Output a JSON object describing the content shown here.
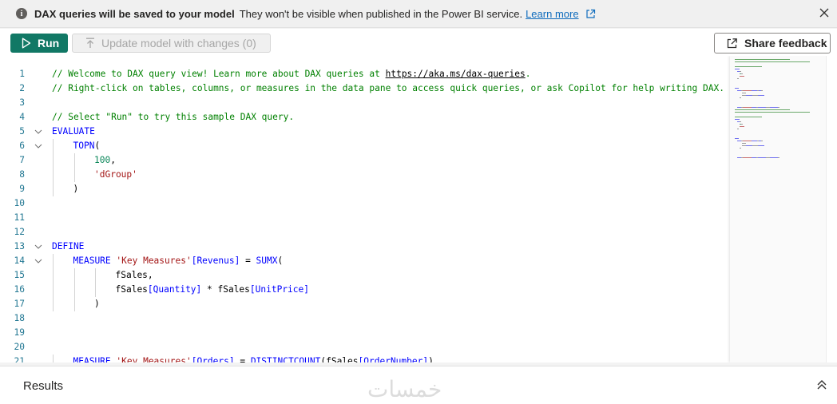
{
  "banner": {
    "title": "DAX queries will be saved to your model",
    "message": "They won't be visible when published in the Power BI service.",
    "link_label": "Learn more"
  },
  "toolbar": {
    "run_label": "Run",
    "update_label": "Update model with changes (0)",
    "share_label": "Share feedback"
  },
  "editor": {
    "lines": [
      {
        "n": "1",
        "indent": 0,
        "fold": false,
        "tokens": [
          [
            "c-comment",
            "// Welcome to DAX query view! Learn more about DAX queries at "
          ],
          [
            "c-link",
            "https://aka.ms/dax-queries"
          ],
          [
            "c-comment",
            "."
          ]
        ]
      },
      {
        "n": "2",
        "indent": 0,
        "fold": false,
        "tokens": [
          [
            "c-comment",
            "// Right-click on tables, columns, or measures in the data pane to access quick queries, or ask Copilot for help writing DAX."
          ]
        ]
      },
      {
        "n": "3",
        "indent": 0,
        "fold": false,
        "tokens": []
      },
      {
        "n": "4",
        "indent": 0,
        "fold": false,
        "tokens": [
          [
            "c-comment",
            "// Select \"Run\" to try this sample DAX query."
          ]
        ]
      },
      {
        "n": "5",
        "indent": 0,
        "fold": true,
        "tokens": [
          [
            "c-kw",
            "EVALUATE"
          ]
        ]
      },
      {
        "n": "6",
        "indent": 1,
        "fold": true,
        "tokens": [
          [
            "c-kw",
            "TOPN"
          ],
          [
            "c-plain",
            "("
          ]
        ]
      },
      {
        "n": "7",
        "indent": 2,
        "fold": false,
        "tokens": [
          [
            "c-num",
            "100"
          ],
          [
            "c-plain",
            ","
          ]
        ]
      },
      {
        "n": "8",
        "indent": 2,
        "fold": false,
        "tokens": [
          [
            "c-str",
            "'dGroup'"
          ]
        ]
      },
      {
        "n": "9",
        "indent": 1,
        "fold": false,
        "tokens": [
          [
            "c-plain",
            ")"
          ]
        ]
      },
      {
        "n": "10",
        "indent": 0,
        "fold": false,
        "tokens": []
      },
      {
        "n": "11",
        "indent": 0,
        "fold": false,
        "tokens": []
      },
      {
        "n": "12",
        "indent": 0,
        "fold": false,
        "tokens": []
      },
      {
        "n": "13",
        "indent": 0,
        "fold": true,
        "tokens": [
          [
            "c-kw",
            "DEFINE"
          ]
        ]
      },
      {
        "n": "14",
        "indent": 1,
        "fold": true,
        "tokens": [
          [
            "c-kw",
            "MEASURE"
          ],
          [
            "c-plain",
            " "
          ],
          [
            "c-str",
            "'Key Measures'"
          ],
          [
            "c-kw",
            "[Revenus]"
          ],
          [
            "c-plain",
            " = "
          ],
          [
            "c-kw",
            "SUMX"
          ],
          [
            "c-plain",
            "("
          ]
        ]
      },
      {
        "n": "15",
        "indent": 3,
        "fold": false,
        "tokens": [
          [
            "c-plain",
            "fSales,"
          ]
        ]
      },
      {
        "n": "16",
        "indent": 3,
        "fold": false,
        "tokens": [
          [
            "c-plain",
            "fSales"
          ],
          [
            "c-kw",
            "[Quantity]"
          ],
          [
            "c-plain",
            " * fSales"
          ],
          [
            "c-kw",
            "[UnitPrice]"
          ]
        ]
      },
      {
        "n": "17",
        "indent": 2,
        "fold": false,
        "tokens": [
          [
            "c-plain",
            ")"
          ]
        ]
      },
      {
        "n": "18",
        "indent": 0,
        "fold": false,
        "tokens": []
      },
      {
        "n": "19",
        "indent": 0,
        "fold": false,
        "tokens": []
      },
      {
        "n": "20",
        "indent": 0,
        "fold": false,
        "tokens": []
      },
      {
        "n": "21",
        "indent": 1,
        "fold": false,
        "tokens": [
          [
            "c-kw",
            "MEASURE"
          ],
          [
            "c-plain",
            " "
          ],
          [
            "c-str",
            "'Key Measures'"
          ],
          [
            "c-kw",
            "[Orders]"
          ],
          [
            "c-plain",
            " = "
          ],
          [
            "c-kw",
            "DISTINCTCOUNT"
          ],
          [
            "c-plain",
            "(fSales"
          ],
          [
            "c-kw",
            "[OrderNumber]"
          ],
          [
            "c-plain",
            ")"
          ]
        ]
      }
    ]
  },
  "results": {
    "title": "Results",
    "watermark": "خمسات"
  },
  "colors": {
    "accent": "#117865",
    "link": "#0f6cbd",
    "comment": "#008000",
    "keyword": "#0000ff",
    "string": "#a31515",
    "number": "#098658"
  }
}
